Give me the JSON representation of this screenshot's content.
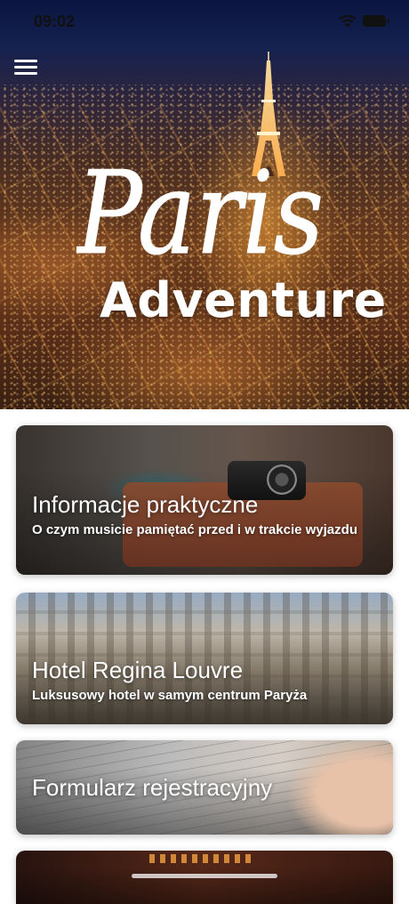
{
  "status_bar": {
    "time": "09:02",
    "wifi_icon": "wifi-icon",
    "battery_icon": "battery-icon"
  },
  "header": {
    "menu_icon": "hamburger-menu-icon",
    "title_line1": "Paris",
    "title_line2": "Adventure"
  },
  "cards": [
    {
      "title": "Informacje praktyczne",
      "subtitle": "O czym musicie pamiętać przed i w trakcie wyjazdu"
    },
    {
      "title": "Hotel Regina Louvre",
      "subtitle": "Luksusowy hotel w samym centrum Paryża"
    },
    {
      "title": "Formularz rejestracyjny",
      "subtitle": ""
    },
    {
      "title": "",
      "subtitle": ""
    }
  ],
  "colors": {
    "card_text": "#ffffff",
    "background": "#ffffff"
  }
}
